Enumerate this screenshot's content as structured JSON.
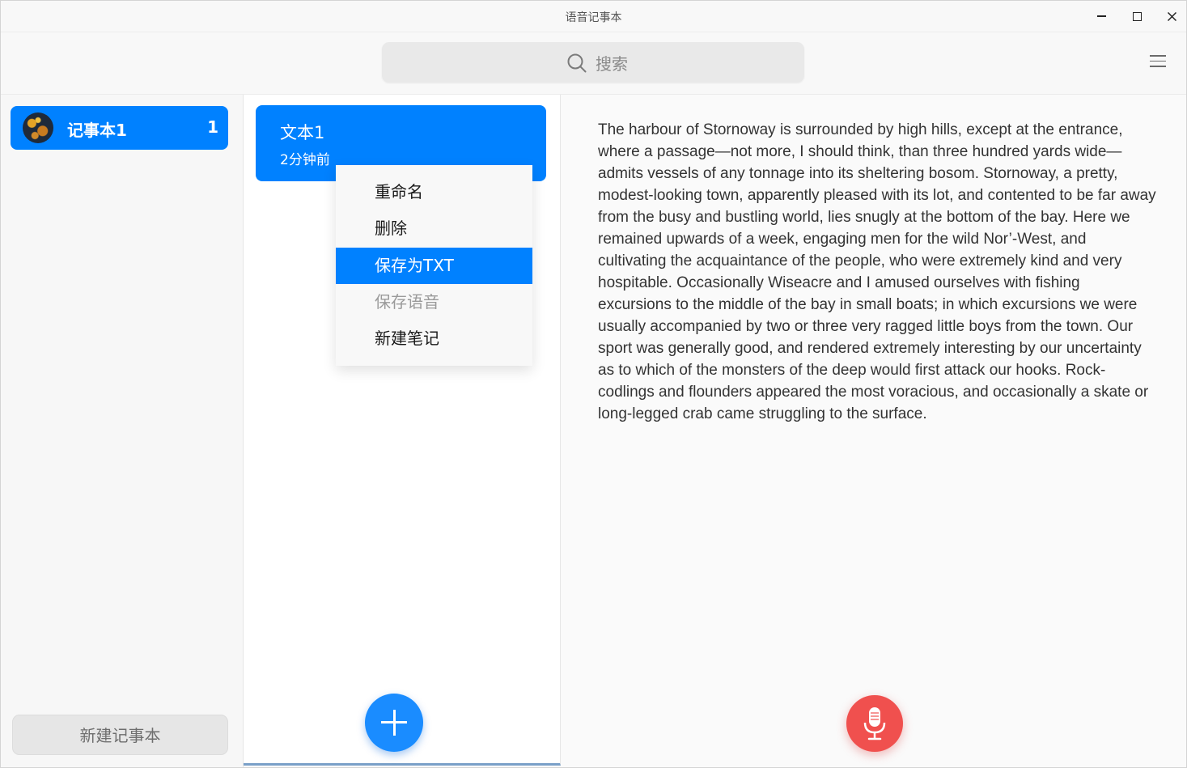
{
  "window": {
    "title": "语音记事本"
  },
  "search": {
    "placeholder": "搜索"
  },
  "notebooks": {
    "items": [
      {
        "name": "记事本1",
        "count": "1"
      }
    ],
    "new_button_label": "新建记事本"
  },
  "notes": {
    "items": [
      {
        "title": "文本1",
        "time": "2分钟前"
      }
    ]
  },
  "context_menu": {
    "items": [
      {
        "label": "重命名",
        "state": "normal"
      },
      {
        "label": "删除",
        "state": "normal"
      },
      {
        "label": "保存为TXT",
        "state": "active"
      },
      {
        "label": "保存语音",
        "state": "disabled"
      },
      {
        "label": "新建笔记",
        "state": "normal"
      }
    ]
  },
  "editor": {
    "content": "The harbour of Stornoway is surrounded by high hills, except at the entrance, where a passage—not more, I should think, than three hundred yards wide—admits vessels of any tonnage into its sheltering bosom. Stornoway, a pretty, modest-looking town, apparently pleased with its lot, and contented to be far away from the busy and bustling world, lies snugly at the bottom of the bay. Here we remained upwards of a week, engaging men for the wild Nor’-West, and cultivating the acquaintance of the people, who were extremely kind and very hospitable. Occasionally Wiseacre and I amused ourselves with fishing excursions to the middle of the bay in small boats; in which excursions we were usually accompanied by two or three very ragged little boys from the town. Our sport was generally good, and rendered extremely interesting by our uncertainty as to which of the monsters of the deep would first attack our hooks. Rock-codlings and flounders appeared the most voracious, and occasionally a skate or long-legged crab came struggling to the surface."
  },
  "colors": {
    "accent": "#0081ff",
    "record": "#f0504e"
  }
}
